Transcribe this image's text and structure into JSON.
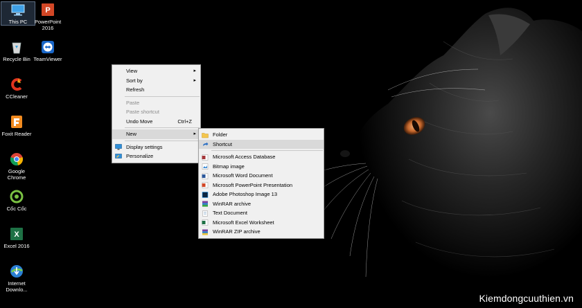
{
  "desktop_icons": [
    {
      "label": "This PC",
      "icon": "computer-icon"
    },
    {
      "label": "PowerPoint 2016",
      "icon": "powerpoint-icon"
    },
    {
      "label": "Recycle Bin",
      "icon": "recycle-bin-icon"
    },
    {
      "label": "TeamViewer",
      "icon": "teamviewer-icon"
    },
    {
      "label": "CCleaner",
      "icon": "ccleaner-icon"
    },
    {
      "label": "Foxit Reader",
      "icon": "foxit-icon"
    },
    {
      "label": "Google Chrome",
      "icon": "chrome-icon"
    },
    {
      "label": "Cốc Cốc",
      "icon": "coccoc-icon"
    },
    {
      "label": "Excel 2016",
      "icon": "excel-icon"
    },
    {
      "label": "Internet Downlo...",
      "icon": "idm-icon"
    }
  ],
  "context_menu": {
    "items": [
      {
        "label": "View",
        "has_submenu": true
      },
      {
        "label": "Sort by",
        "has_submenu": true
      },
      {
        "label": "Refresh"
      },
      {
        "label": "Paste",
        "disabled": true
      },
      {
        "label": "Paste shortcut",
        "disabled": true
      },
      {
        "label": "Undo Move",
        "shortcut": "Ctrl+Z"
      },
      {
        "label": "New",
        "has_submenu": true,
        "highlighted": true
      },
      {
        "label": "Display settings",
        "icon": "display-settings-icon"
      },
      {
        "label": "Personalize",
        "icon": "personalize-icon"
      }
    ]
  },
  "new_submenu": {
    "items": [
      {
        "label": "Folder",
        "icon": "folder-icon"
      },
      {
        "label": "Shortcut",
        "icon": "shortcut-icon",
        "highlighted": true
      },
      {
        "label": "Microsoft Access Database",
        "icon": "access-icon"
      },
      {
        "label": "Bitmap image",
        "icon": "bitmap-icon"
      },
      {
        "label": "Microsoft Word Document",
        "icon": "word-icon"
      },
      {
        "label": "Microsoft PowerPoint Presentation",
        "icon": "powerpoint-icon"
      },
      {
        "label": "Adobe Photoshop Image 13",
        "icon": "photoshop-icon"
      },
      {
        "label": "WinRAR archive",
        "icon": "winrar-icon"
      },
      {
        "label": "Text Document",
        "icon": "text-document-icon"
      },
      {
        "label": "Microsoft Excel Worksheet",
        "icon": "excel-icon"
      },
      {
        "label": "WinRAR ZIP archive",
        "icon": "winrar-zip-icon"
      }
    ]
  },
  "watermark": "Kiemdongcuuthien.vn"
}
